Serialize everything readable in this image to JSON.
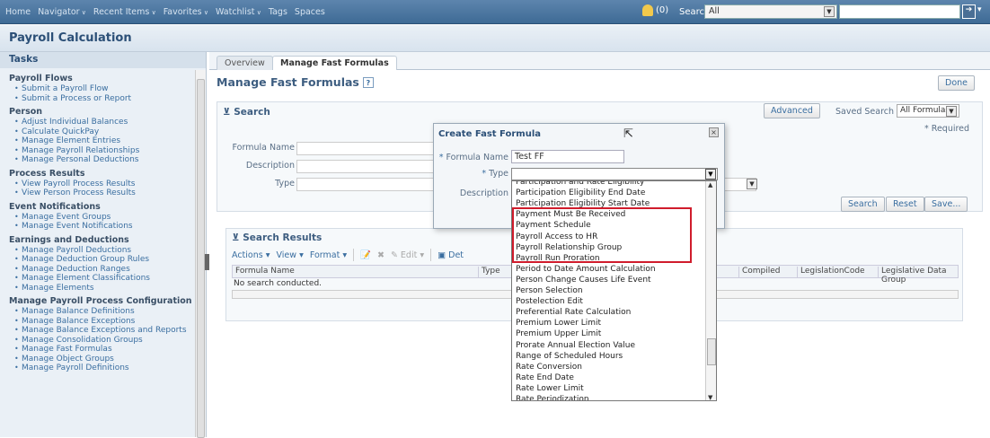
{
  "topbar": {
    "nav": [
      {
        "label": "Home",
        "dropdown": false
      },
      {
        "label": "Navigator",
        "dropdown": true
      },
      {
        "label": "Recent Items",
        "dropdown": true
      },
      {
        "label": "Favorites",
        "dropdown": true
      },
      {
        "label": "Watchlist",
        "dropdown": true
      },
      {
        "label": "Tags",
        "dropdown": false
      },
      {
        "label": "Spaces",
        "dropdown": false
      }
    ],
    "notifications": "(0)",
    "search_label": "Search",
    "search_scope": "All"
  },
  "page_title": "Payroll Calculation",
  "tasks": {
    "header": "Tasks",
    "sections": [
      {
        "title": "Payroll Flows",
        "items": [
          "Submit a Payroll Flow",
          "Submit a Process or Report"
        ]
      },
      {
        "title": "Person",
        "items": [
          "Adjust Individual Balances",
          "Calculate QuickPay",
          "Manage Element Entries",
          "Manage Payroll Relationships",
          "Manage Personal Deductions"
        ]
      },
      {
        "title": "Process Results",
        "items": [
          "View Payroll Process Results",
          "View Person Process Results"
        ]
      },
      {
        "title": "Event Notifications",
        "items": [
          "Manage Event Groups",
          "Manage Event Notifications"
        ]
      },
      {
        "title": "Earnings and Deductions",
        "items": [
          "Manage Payroll Deductions",
          "Manage Deduction Group Rules",
          "Manage Deduction Ranges",
          "Manage Element Classifications",
          "Manage Elements"
        ]
      },
      {
        "title": "Manage Payroll Process Configuration",
        "items": [
          "Manage Balance Definitions",
          "Manage Balance Exceptions",
          "Manage Balance Exceptions and Reports",
          "Manage Consolidation Groups",
          "Manage Fast Formulas",
          "Manage Object Groups",
          "Manage Payroll Definitions"
        ]
      }
    ]
  },
  "main": {
    "tabs": [
      "Overview",
      "Manage Fast Formulas"
    ],
    "heading": "Manage Fast Formulas",
    "done_label": "Done",
    "search": {
      "title": "Search",
      "advanced_label": "Advanced",
      "saved_search_label": "Saved Search",
      "saved_search_value": "All Formulas",
      "required_label": "* Required",
      "fields": [
        "Formula Name",
        "Description",
        "Type"
      ],
      "buttons": [
        "Search",
        "Reset",
        "Save..."
      ]
    },
    "results": {
      "title": "Search Results",
      "toolbar": {
        "actions": "Actions",
        "view": "View",
        "format": "Format",
        "edit": "Edit",
        "detach": "Det"
      },
      "columns": [
        "Formula Name",
        "Type",
        "Compiled",
        "LegislationCode",
        "Legislative Data Group"
      ],
      "empty_text": "No search conducted."
    }
  },
  "dialog": {
    "title": "Create Fast Formula",
    "name_label": "Formula Name",
    "name_value": "Test FF",
    "type_label": "Type",
    "description_label": "Description"
  },
  "type_options": [
    "Participation and Rate Eligibility",
    "Participation Eligibility End Date",
    "Participation Eligibility Start Date",
    "Payment Must Be Received",
    "Payment Schedule",
    "Payroll Access to HR",
    "Payroll Relationship Group",
    "Payroll Run Proration",
    "Period to Date Amount Calculation",
    "Person Change Causes Life Event",
    "Person Selection",
    "Postelection Edit",
    "Preferential Rate Calculation",
    "Premium Lower Limit",
    "Premium Upper Limit",
    "Prorate Annual Election Value",
    "Range of Scheduled Hours",
    "Rate Conversion",
    "Rate End Date",
    "Rate Lower Limit",
    "Rate Periodization"
  ],
  "highlight_color": "#d01c2c"
}
